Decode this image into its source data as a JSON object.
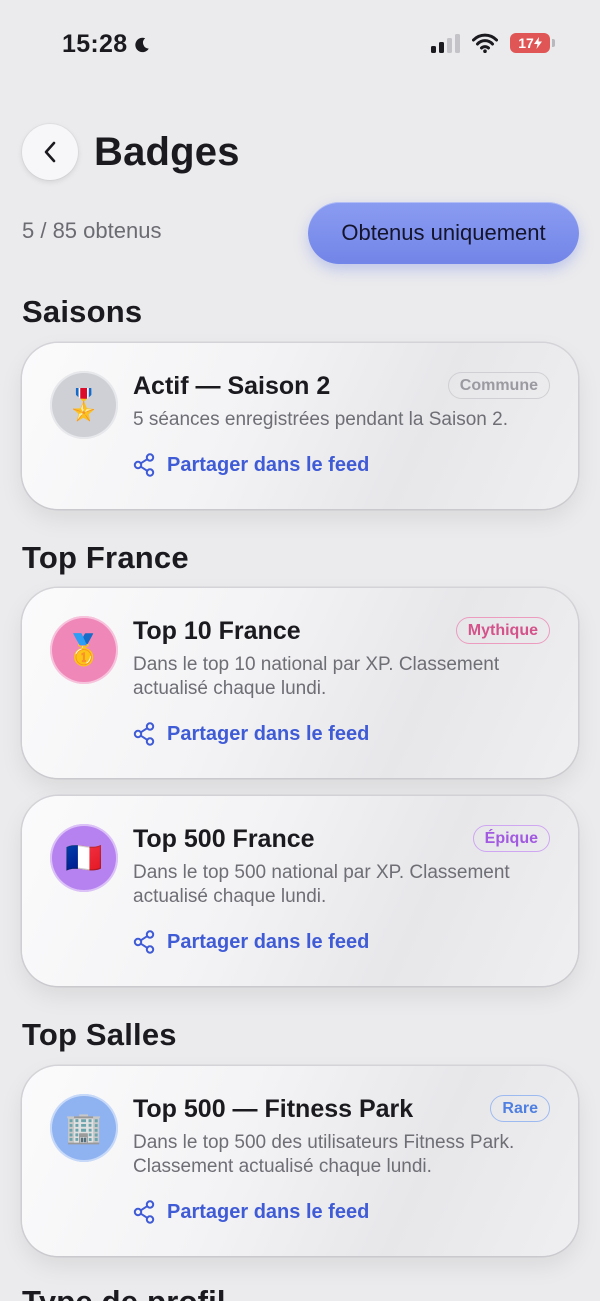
{
  "status_bar": {
    "time": "15:28",
    "battery": "17"
  },
  "header": {
    "title": "Badges"
  },
  "summary": {
    "count_text": "5 / 85 obtenus"
  },
  "filter": {
    "label": "Obtenus uniquement",
    "accent_color": "#7b8ded"
  },
  "share_label": "Partager dans le feed",
  "sections": [
    {
      "title": "Saisons",
      "badges": [
        {
          "icon": "🎖️",
          "icon_name": "military-medal-icon",
          "title": "Actif — Saison 2",
          "rarity": "Commune",
          "description": "5 séances enregistrées pendant la Saison 2."
        }
      ]
    },
    {
      "title": "Top France",
      "badges": [
        {
          "icon": "🥇",
          "icon_name": "gold-medal-icon",
          "title": "Top 10 France",
          "rarity": "Mythique",
          "description": "Dans le top 10 national par XP. Classement actualisé chaque lundi."
        },
        {
          "icon": "🇫🇷",
          "icon_name": "france-flag-icon",
          "title": "Top 500 France",
          "rarity": "Épique",
          "description": "Dans le top 500 national par XP. Classement actualisé chaque lundi."
        }
      ]
    },
    {
      "title": "Top Salles",
      "badges": [
        {
          "icon": "🏢",
          "icon_name": "office-building-icon",
          "title": "Top 500 — Fitness Park",
          "rarity": "Rare",
          "description": "Dans le top 500 des utilisateurs Fitness Park. Classement actualisé chaque lundi."
        }
      ]
    },
    {
      "title": "Type de profil",
      "badges": []
    }
  ],
  "rarity_colors": {
    "Commune": {
      "text": "#9a9aa0",
      "border": "#d0d0d4",
      "icon_bg": "#cfd0d6"
    },
    "Mythique": {
      "text": "#d4538a",
      "border": "#ec9cbf",
      "icon_bg": "#ef87b8"
    },
    "Épique": {
      "text": "#a25ae0",
      "border": "#cfa6f2",
      "icon_bg": "#b682ef"
    },
    "Rare": {
      "text": "#4f7fe0",
      "border": "#9dbaf0",
      "icon_bg": "#8fb2f1"
    }
  }
}
